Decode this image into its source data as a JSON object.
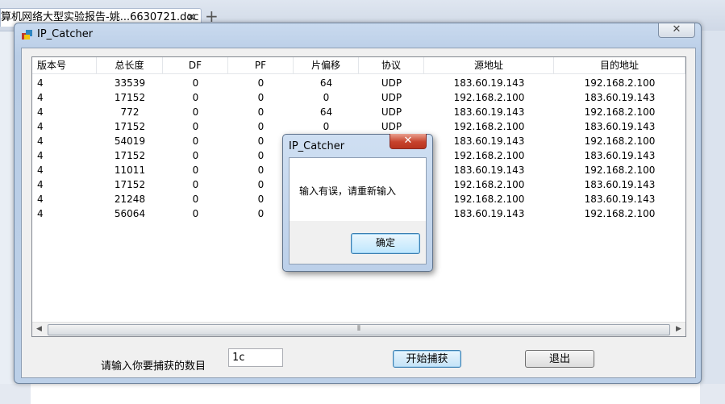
{
  "background": {
    "doc_tab_title": "算机网络大型实验报告-姚...6630721.doc *",
    "doc_tab_close": "✕",
    "new_tab": "+"
  },
  "window": {
    "title": "IP_Catcher",
    "close_glyph": "✕"
  },
  "table": {
    "columns": [
      "版本号",
      "总长度",
      "DF",
      "PF",
      "片偏移",
      "协议",
      "源地址",
      "目的地址"
    ],
    "rows": [
      [
        "4",
        "33539",
        "0",
        "0",
        "64",
        "UDP",
        "183.60.19.143",
        "192.168.2.100"
      ],
      [
        "4",
        "17152",
        "0",
        "0",
        "0",
        "UDP",
        "192.168.2.100",
        "183.60.19.143"
      ],
      [
        "4",
        "772",
        "0",
        "0",
        "64",
        "UDP",
        "183.60.19.143",
        "192.168.2.100"
      ],
      [
        "4",
        "17152",
        "0",
        "0",
        "0",
        "UDP",
        "192.168.2.100",
        "183.60.19.143"
      ],
      [
        "4",
        "54019",
        "0",
        "0",
        "",
        "",
        "183.60.19.143",
        "192.168.2.100"
      ],
      [
        "4",
        "17152",
        "0",
        "0",
        "",
        "",
        "192.168.2.100",
        "183.60.19.143"
      ],
      [
        "4",
        "11011",
        "0",
        "0",
        "",
        "",
        "183.60.19.143",
        "192.168.2.100"
      ],
      [
        "4",
        "17152",
        "0",
        "0",
        "",
        "",
        "192.168.2.100",
        "183.60.19.143"
      ],
      [
        "4",
        "21248",
        "0",
        "0",
        "",
        "",
        "192.168.2.100",
        "183.60.19.143"
      ],
      [
        "4",
        "56064",
        "0",
        "0",
        "",
        "",
        "183.60.19.143",
        "192.168.2.100"
      ]
    ],
    "scroll_grip": "⦀"
  },
  "controls": {
    "prompt_label": "请输入你要捕获的数目",
    "count_value": "1c",
    "start_button": "开始捕获",
    "exit_button": "退出"
  },
  "dialog": {
    "title": "IP_Catcher",
    "close_glyph": "✕",
    "message": "输入有误，请重新输入",
    "ok_button": "确定"
  },
  "colors": {
    "title_bar": "#c9daef",
    "dialog_close": "#c7432c",
    "focus_button": "#3c7fb1"
  }
}
